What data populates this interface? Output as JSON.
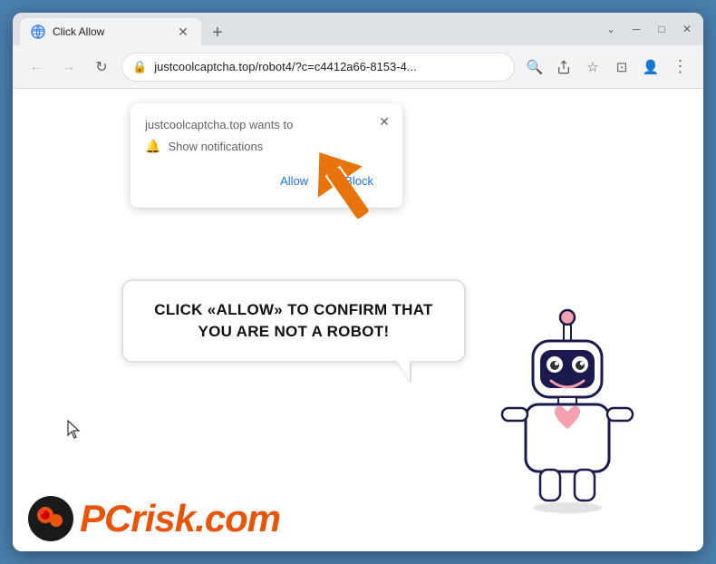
{
  "browser": {
    "tab": {
      "title": "Click Allow",
      "favicon": "globe"
    },
    "new_tab_label": "+",
    "window_controls": {
      "chevron": "⌄",
      "minimize": "─",
      "maximize": "□",
      "close": "✕"
    },
    "nav": {
      "back": "←",
      "forward": "→",
      "refresh": "↻"
    },
    "url": {
      "lock": "🔒",
      "text": "justcoolcaptcha.top/robot4/?c=c4412a66-8153-4...",
      "search_icon": "🔍",
      "share_icon": "⎋",
      "bookmark_icon": "☆",
      "split_icon": "⊡",
      "profile_icon": "👤",
      "menu_icon": "⋮"
    }
  },
  "notification_dialog": {
    "title": "justcoolcaptcha.top wants to",
    "permission": "Show notifications",
    "allow_label": "Allow",
    "block_label": "Block",
    "close_icon": "✕"
  },
  "speech_bubble": {
    "text": "CLICK «ALLOW» TO CONFIRM THAT YOU ARE NOT A ROBOT!"
  },
  "pcrisk": {
    "name_prefix": "PC",
    "name_suffix": "risk.com"
  },
  "colors": {
    "accent_blue": "#4a7fad",
    "orange_arrow": "#e8730a",
    "link_blue": "#1a73e8"
  }
}
